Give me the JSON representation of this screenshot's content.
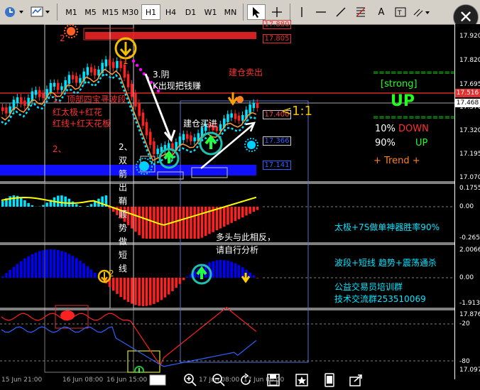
{
  "toolbar": {
    "timeframes": [
      "M1",
      "M5",
      "M15",
      "M30",
      "H1",
      "H4",
      "D1",
      "W1",
      "MN"
    ],
    "active_timeframe": "H1",
    "tools": [
      "cursor-icon",
      "crosshair-icon",
      "vertical-line-icon",
      "horizontal-line-icon",
      "trendline-icon",
      "fibo-icon",
      "text-icon",
      "text-label-icon",
      "shapes-icon"
    ],
    "close_glyph": "✕"
  },
  "price_axis": {
    "main": [
      "17.920",
      "17.820",
      "17.695",
      "17.570",
      "17.445",
      "17.320",
      "17.195",
      "17.070"
    ],
    "osc1": [
      "0.1755",
      "0.00",
      "-0.2658"
    ],
    "osc2": [
      "2.0066",
      "0.00",
      "-1.9132"
    ],
    "osc3": [
      "17.8764",
      "-20",
      "-80",
      "17.0976"
    ]
  },
  "price_tags": {
    "red": "17.516",
    "white": "17.468"
  },
  "levels": [
    "17.880",
    "17.805",
    "17.400",
    "17.366",
    "17.141"
  ],
  "annotations": {
    "a1": "1、顶部四宝寻波段",
    "a1b": "红太极+红花",
    "a1c": "红线+红天花板",
    "a2": "2、",
    "a3": "3.阴",
    "a3b": "K出现把钱赚",
    "a_sell": "建仓卖出",
    "a_buy": "建仓买进",
    "ratio": "<1:1",
    "double_arrow": "2、双箭出鞘顺势做短线",
    "opposite": "多头与此相反，",
    "analyze": "请自行分析",
    "num_two": "2",
    "num_1": "1",
    "num_2": "2"
  },
  "panel": {
    "strong_dashes": "==============",
    "strong": "[strong]",
    "up": "UP",
    "pct_down": "10%",
    "down_label": "DOWN",
    "pct_up": "90%",
    "up_label": "UP",
    "trend": "+ Trend +"
  },
  "promo": {
    "line1": "太极+7S做单神器胜率90%",
    "line2": "波段+短线  趋势+震荡通杀",
    "line3": "公益交易员培训群",
    "line4": "技术交流群253510069"
  },
  "time_axis": [
    "15 Jun 21:00",
    "16 Jun 08:00",
    "16 Jun 15:00",
    "17 Jun 08:00",
    "17 Jun 06:00"
  ],
  "bottom_tools": [
    "chart-icon",
    "zoom-in-icon",
    "zoom-out-icon",
    "refresh-icon",
    "save-icon",
    "bookmark-icon",
    "phone-icon",
    "share-icon"
  ],
  "colors": {
    "bull": "#00e5ff",
    "bear": "#ff2020",
    "orange": "#ff9b3a",
    "yellow": "#ffff00",
    "green": "#00ff00",
    "blue": "#0000ff",
    "magenta": "#ff00ff"
  }
}
